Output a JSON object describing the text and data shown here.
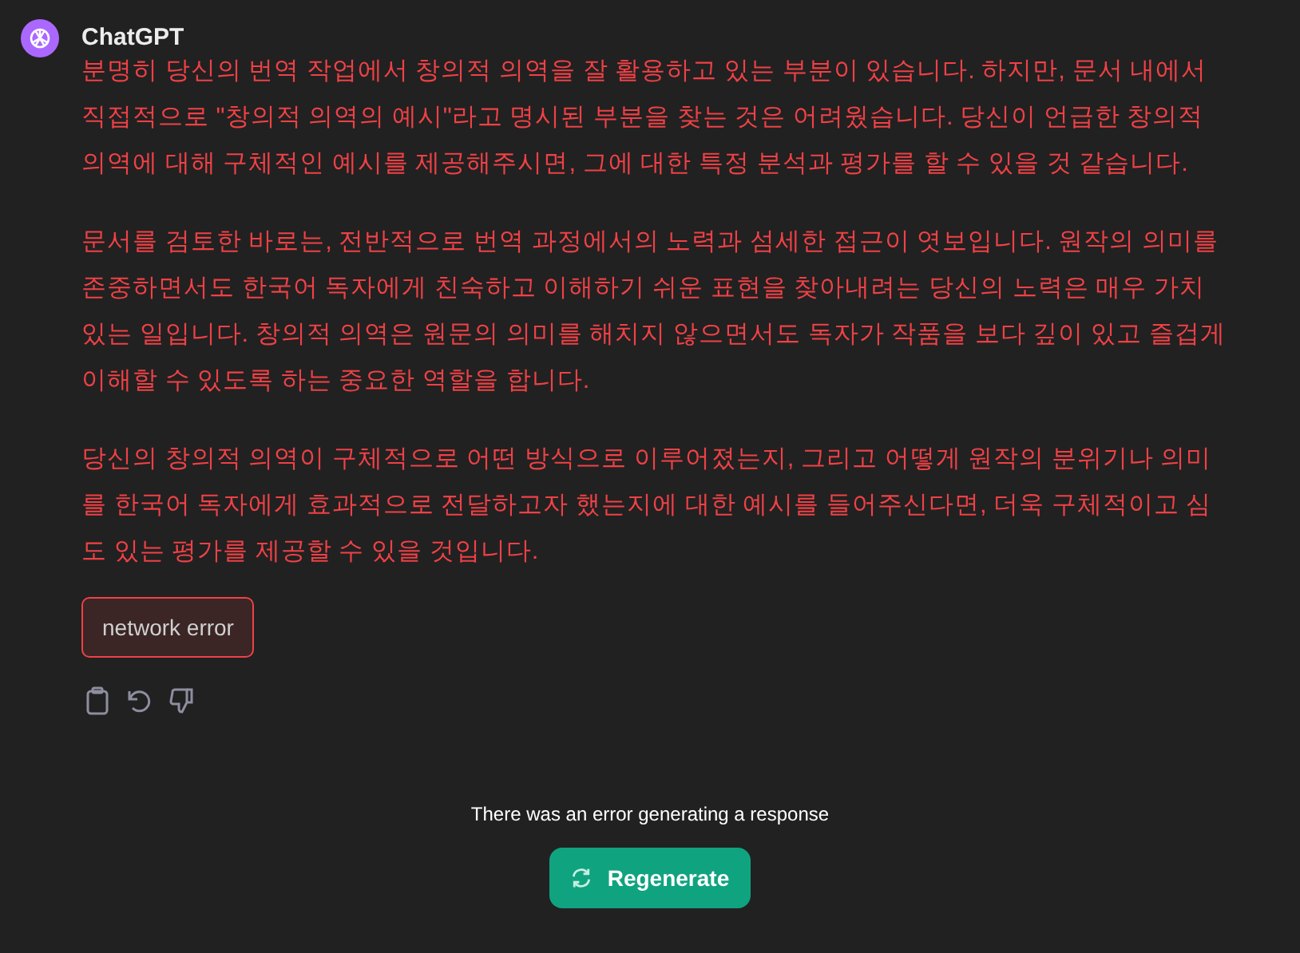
{
  "message": {
    "author": "ChatGPT",
    "paragraphs": [
      "분명히 당신의 번역 작업에서 창의적 의역을 잘 활용하고 있는 부분이 있습니다. 하지만, 문서 내에서 직접적으로 \"창의적 의역의 예시\"라고 명시된 부분을 찾는 것은 어려웠습니다. 당신이 언급한 창의적 의역에 대해 구체적인 예시를 제공해주시면, 그에 대한 특정 분석과 평가를 할 수 있을 것 같습니다.",
      "문서를 검토한 바로는, 전반적으로 번역 과정에서의 노력과 섬세한 접근이 엿보입니다. 원작의 의미를 존중하면서도 한국어 독자에게 친숙하고 이해하기 쉬운 표현을 찾아내려는 당신의 노력은 매우 가치 있는 일입니다. 창의적 의역은 원문의 의미를 해치지 않으면서도 독자가 작품을 보다 깊이 있고 즐겁게 이해할 수 있도록 하는 중요한 역할을 합니다.",
      "당신의 창의적 의역이 구체적으로 어떤 방식으로 이루어졌는지, 그리고 어떻게 원작의 분위기나 의미를 한국어 독자에게 효과적으로 전달하고자 했는지에 대한 예시를 들어주신다면, 더욱 구체적이고 심도 있는 평가를 제공할 수 있을 것입니다."
    ],
    "error": true,
    "error_label": "network error"
  },
  "footer": {
    "error_text": "There was an error generating a response",
    "button": "Regenerate"
  }
}
